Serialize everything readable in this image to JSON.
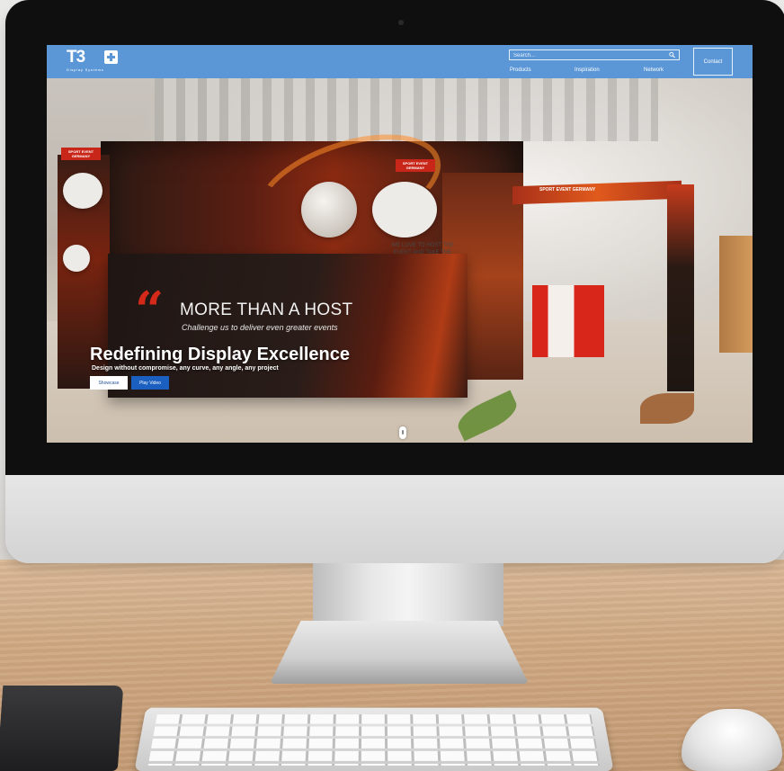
{
  "header": {
    "logo_text": "T3",
    "logo_subtitle": "Display Systems",
    "search_placeholder": "Search...",
    "nav": [
      "Products",
      "Inspiration",
      "Network"
    ],
    "contact_label": "Contact"
  },
  "hero": {
    "title": "Redefining Display Excellence",
    "subtitle": "Design without compromise, any curve, any angle, any project",
    "showcase_label": "Showcase",
    "video_label": "Play Video",
    "booth_headline": "MORE THAN A HOST",
    "booth_tagline": "Challenge us to deliver even greater events",
    "bubble_text": "WE LOVE TO HOST THE EVENT AND TAKE THE EVENT TO THE NEXT LEVEL",
    "banner_text": "SPORT EVENT GERMANY",
    "tag_text": "SPORT EVENT GERMANY"
  },
  "colors": {
    "header_bg": "#5b97d6",
    "play_button": "#1b5fc0",
    "booth_red": "#d52a1a"
  }
}
